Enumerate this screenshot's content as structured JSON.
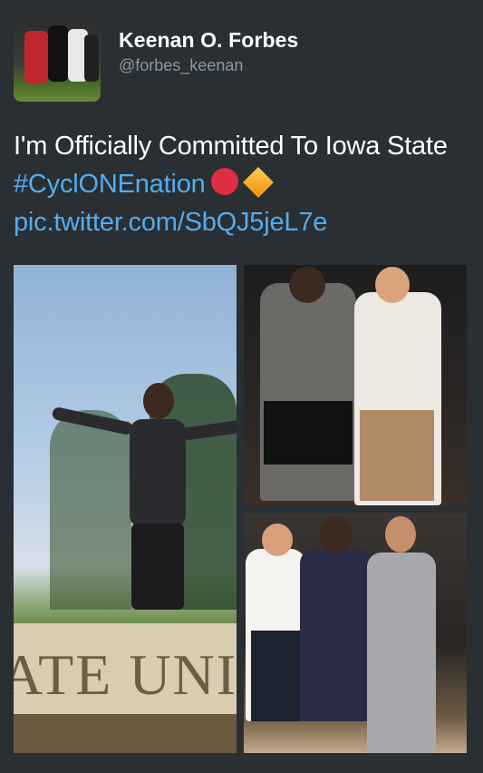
{
  "user": {
    "name": "Keenan O. Forbes",
    "handle": "@forbes_keenan"
  },
  "tweet": {
    "text": "I'm Officially Committed To Iowa State ",
    "hashtag": "#CyclONEnation",
    "emoji": [
      "red-circle",
      "orange-diamond"
    ],
    "link": "pic.twitter.com/SbQJ5jeL7e"
  },
  "photos": [
    {
      "sign_text": "ATE UNIV"
    },
    {},
    {}
  ],
  "colors": {
    "background": "#292f33",
    "link": "#55acee",
    "handle": "#8899a6"
  }
}
